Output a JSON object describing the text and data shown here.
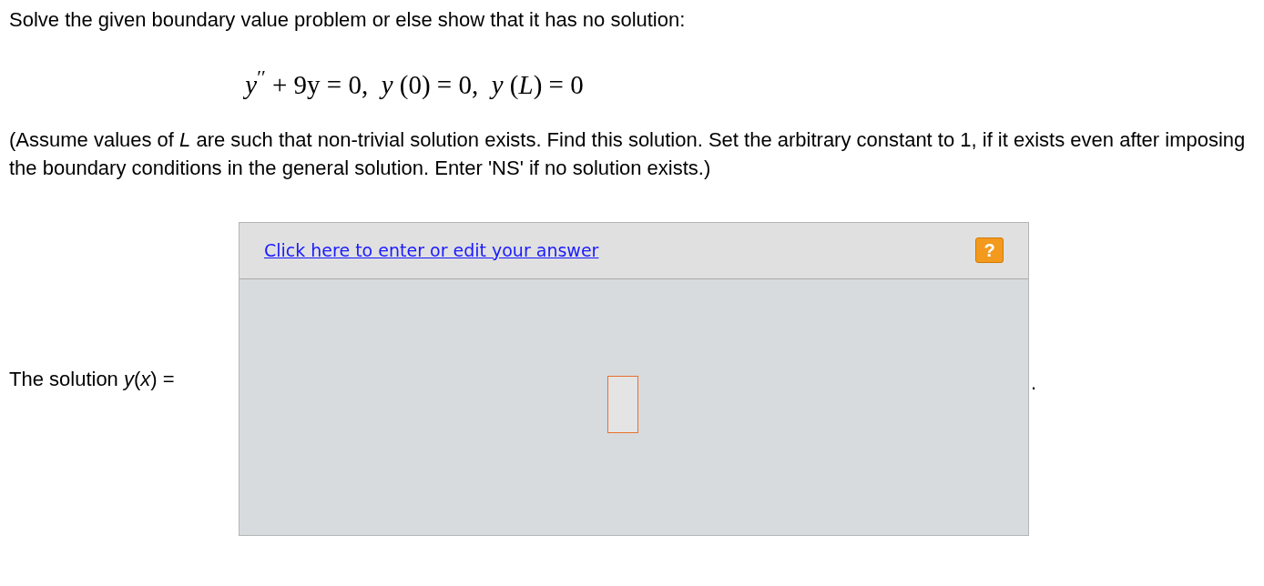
{
  "question": "Solve the given boundary value problem or else show that it has no solution:",
  "equation": "*y*$^{′′}$ + 9y = 0,  *y* (0) = 0,  *y* (*L*) = 0",
  "instructions": "(Assume values of *L* are such that non-trivial solution exists. Find this solution. Set the arbitrary constant to 1, if it exists even after imposing the boundary conditions in the general solution. Enter 'NS' if no solution exists.)",
  "answer": {
    "label": "The solution *y*(*x*) =",
    "link": "Click here to enter or edit your answer",
    "help": "?",
    "trailing": "."
  }
}
